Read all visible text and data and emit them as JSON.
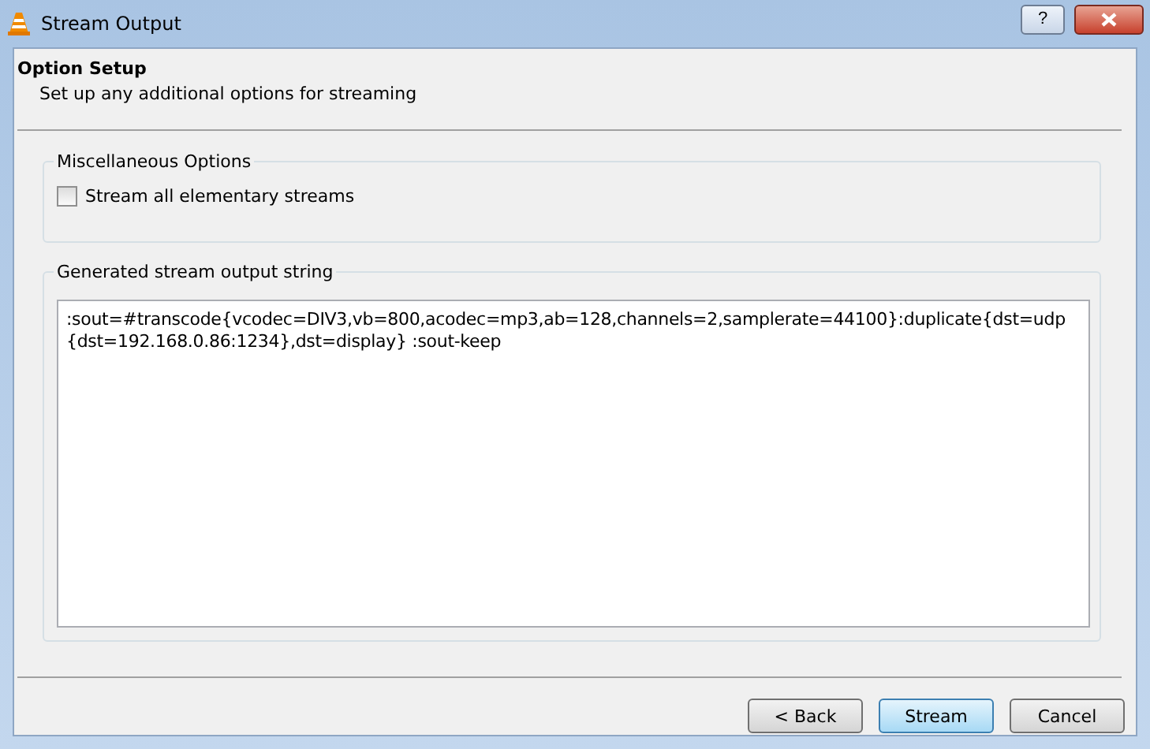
{
  "window": {
    "title": "Stream Output",
    "help_button": "?"
  },
  "header": {
    "title": "Option Setup",
    "subtitle": "Set up any additional options for streaming"
  },
  "misc_options": {
    "title": "Miscellaneous Options",
    "checkbox": {
      "label": "Stream all elementary streams",
      "checked": false
    }
  },
  "output_string": {
    "title": "Generated stream output string",
    "value": ":sout=#transcode{vcodec=DIV3,vb=800,acodec=mp3,ab=128,channels=2,samplerate=44100}:duplicate{dst=udp{dst=192.168.0.86:1234},dst=display} :sout-keep"
  },
  "buttons": [
    {
      "label": "< Back",
      "default": false
    },
    {
      "label": "Stream",
      "default": true
    },
    {
      "label": "Cancel",
      "default": false
    }
  ]
}
